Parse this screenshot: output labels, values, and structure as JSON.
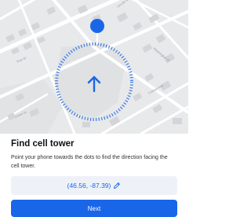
{
  "map": {
    "street_labels": [
      "Lincoln Rd",
      "Washington St",
      "Pine St",
      "College Ave",
      "Union St"
    ]
  },
  "compass": {
    "icon": "direction-arrow-icon",
    "accent_color": "#1a66e8",
    "user_dot_color": "#1a66e8"
  },
  "panel": {
    "title": "Find cell tower",
    "description": "Point your phone towards the dots to find the direction facing the cell tower.",
    "coordinates": "(46.56, -87.39)",
    "edit_icon": "pencil-icon",
    "next_label": "Next"
  }
}
